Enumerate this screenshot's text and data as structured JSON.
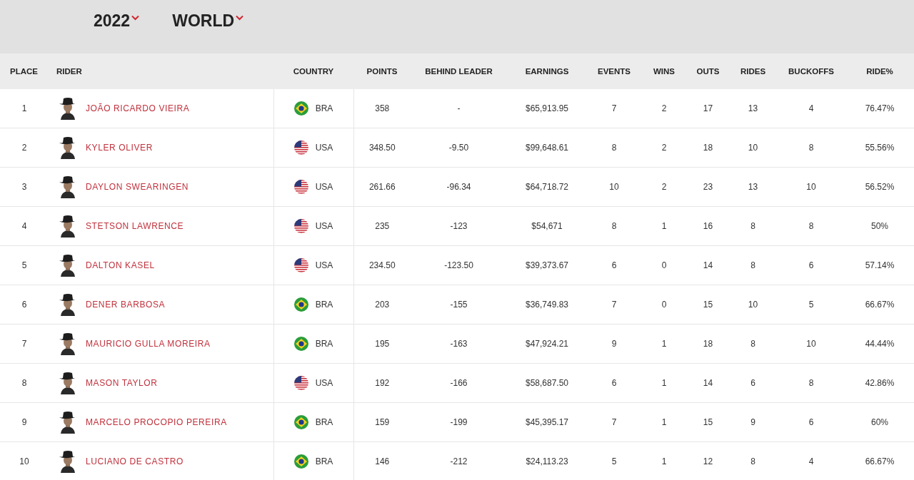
{
  "filters": [
    {
      "label": "2022"
    },
    {
      "label": "WORLD"
    }
  ],
  "table": {
    "columns": [
      "PLACE",
      "RIDER",
      "COUNTRY",
      "POINTS",
      "BEHIND LEADER",
      "EARNINGS",
      "EVENTS",
      "WINS",
      "OUTS",
      "RIDES",
      "BUCKOFFS",
      "RIDE%"
    ],
    "rows": [
      {
        "place": "1",
        "rider": "JOÃO RICARDO VIEIRA",
        "kind": "brazil",
        "country": "BRA",
        "points": "358",
        "behind_leader": "-",
        "earnings": "$65,913.95",
        "events": "7",
        "wins": "2",
        "outs": "17",
        "rides": "13",
        "buckoffs": "4",
        "ride_pct": "76.47%"
      },
      {
        "place": "2",
        "rider": "KYLER OLIVER",
        "kind": "usa",
        "country": "USA",
        "points": "348.50",
        "behind_leader": "-9.50",
        "earnings": "$99,648.61",
        "events": "8",
        "wins": "2",
        "outs": "18",
        "rides": "10",
        "buckoffs": "8",
        "ride_pct": "55.56%"
      },
      {
        "place": "3",
        "rider": "DAYLON SWEARINGEN",
        "kind": "usa",
        "country": "USA",
        "points": "261.66",
        "behind_leader": "-96.34",
        "earnings": "$64,718.72",
        "events": "10",
        "wins": "2",
        "outs": "23",
        "rides": "13",
        "buckoffs": "10",
        "ride_pct": "56.52%"
      },
      {
        "place": "4",
        "rider": "STETSON LAWRENCE",
        "kind": "usa",
        "country": "USA",
        "points": "235",
        "behind_leader": "-123",
        "earnings": "$54,671",
        "events": "8",
        "wins": "1",
        "outs": "16",
        "rides": "8",
        "buckoffs": "8",
        "ride_pct": "50%"
      },
      {
        "place": "5",
        "rider": "DALTON KASEL",
        "kind": "usa",
        "country": "USA",
        "points": "234.50",
        "behind_leader": "-123.50",
        "earnings": "$39,373.67",
        "events": "6",
        "wins": "0",
        "outs": "14",
        "rides": "8",
        "buckoffs": "6",
        "ride_pct": "57.14%"
      },
      {
        "place": "6",
        "rider": "DENER BARBOSA",
        "kind": "brazil",
        "country": "BRA",
        "points": "203",
        "behind_leader": "-155",
        "earnings": "$36,749.83",
        "events": "7",
        "wins": "0",
        "outs": "15",
        "rides": "10",
        "buckoffs": "5",
        "ride_pct": "66.67%"
      },
      {
        "place": "7",
        "rider": "MAURICIO GULLA MOREIRA",
        "kind": "brazil",
        "country": "BRA",
        "points": "195",
        "behind_leader": "-163",
        "earnings": "$47,924.21",
        "events": "9",
        "wins": "1",
        "outs": "18",
        "rides": "8",
        "buckoffs": "10",
        "ride_pct": "44.44%"
      },
      {
        "place": "8",
        "rider": "MASON TAYLOR",
        "kind": "usa",
        "country": "USA",
        "points": "192",
        "behind_leader": "-166",
        "earnings": "$58,687.50",
        "events": "6",
        "wins": "1",
        "outs": "14",
        "rides": "6",
        "buckoffs": "8",
        "ride_pct": "42.86%"
      },
      {
        "place": "9",
        "rider": "MARCELO PROCOPIO PEREIRA",
        "kind": "brazil",
        "country": "BRA",
        "points": "159",
        "behind_leader": "-199",
        "earnings": "$45,395.17",
        "events": "7",
        "wins": "1",
        "outs": "15",
        "rides": "9",
        "buckoffs": "6",
        "ride_pct": "60%"
      },
      {
        "place": "10",
        "rider": "LUCIANO DE CASTRO",
        "kind": "brazil",
        "country": "BRA",
        "points": "146",
        "behind_leader": "-212",
        "earnings": "$24,113.23",
        "events": "5",
        "wins": "1",
        "outs": "12",
        "rides": "8",
        "buckoffs": "4",
        "ride_pct": "66.67%"
      }
    ]
  }
}
